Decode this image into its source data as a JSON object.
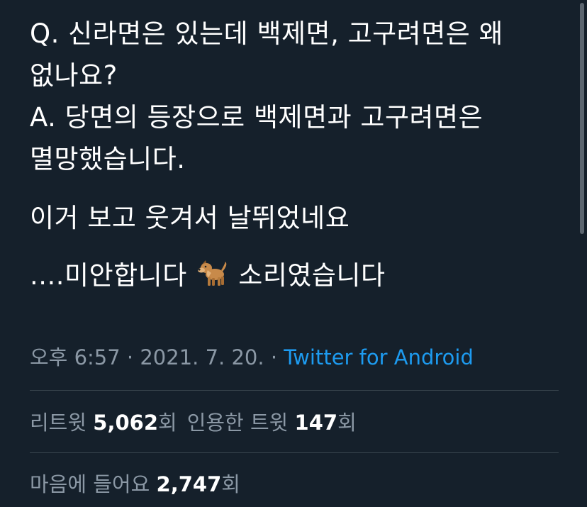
{
  "tweet": {
    "lines": [
      "Q. 신라면은 있는데 백제면, 고구려면은 왜",
      "없나요?",
      "A. 당면의 등장으로 백제면과 고구려면은",
      "멸망했습니다.",
      "이거 보고 웃겨서 날뛰었네요"
    ],
    "last_line_prefix": "....미안합니다",
    "last_line_suffix": "소리였습니다",
    "emoji_icon": "dog-icon"
  },
  "meta": {
    "time": "오후 6:57",
    "separator": "·",
    "date": "2021. 7. 20.",
    "source": "Twitter for Android"
  },
  "stats": {
    "retweets_label": "리트윗",
    "retweets_count": "5,062",
    "quote_label": "인용한 트윗",
    "quote_count": "147",
    "likes_label": "마음에 들어요",
    "likes_count": "2,747",
    "unit": "회"
  },
  "colors": {
    "background": "#15202b",
    "text": "#ffffff",
    "muted": "#8b98a5",
    "link": "#1d9bf0",
    "divider": "#38444d"
  }
}
